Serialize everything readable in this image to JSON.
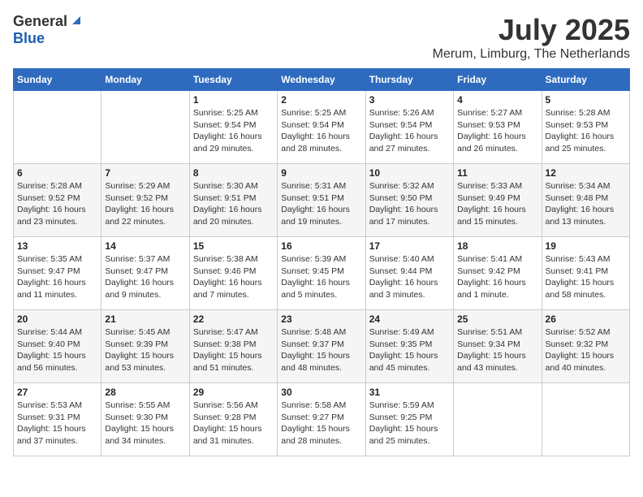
{
  "logo": {
    "general": "General",
    "blue": "Blue"
  },
  "title": {
    "month": "July 2025",
    "location": "Merum, Limburg, The Netherlands"
  },
  "header_days": [
    "Sunday",
    "Monday",
    "Tuesday",
    "Wednesday",
    "Thursday",
    "Friday",
    "Saturday"
  ],
  "weeks": [
    {
      "days": [
        {
          "num": "",
          "info": ""
        },
        {
          "num": "",
          "info": ""
        },
        {
          "num": "1",
          "info": "Sunrise: 5:25 AM\nSunset: 9:54 PM\nDaylight: 16 hours\nand 29 minutes."
        },
        {
          "num": "2",
          "info": "Sunrise: 5:25 AM\nSunset: 9:54 PM\nDaylight: 16 hours\nand 28 minutes."
        },
        {
          "num": "3",
          "info": "Sunrise: 5:26 AM\nSunset: 9:54 PM\nDaylight: 16 hours\nand 27 minutes."
        },
        {
          "num": "4",
          "info": "Sunrise: 5:27 AM\nSunset: 9:53 PM\nDaylight: 16 hours\nand 26 minutes."
        },
        {
          "num": "5",
          "info": "Sunrise: 5:28 AM\nSunset: 9:53 PM\nDaylight: 16 hours\nand 25 minutes."
        }
      ]
    },
    {
      "days": [
        {
          "num": "6",
          "info": "Sunrise: 5:28 AM\nSunset: 9:52 PM\nDaylight: 16 hours\nand 23 minutes."
        },
        {
          "num": "7",
          "info": "Sunrise: 5:29 AM\nSunset: 9:52 PM\nDaylight: 16 hours\nand 22 minutes."
        },
        {
          "num": "8",
          "info": "Sunrise: 5:30 AM\nSunset: 9:51 PM\nDaylight: 16 hours\nand 20 minutes."
        },
        {
          "num": "9",
          "info": "Sunrise: 5:31 AM\nSunset: 9:51 PM\nDaylight: 16 hours\nand 19 minutes."
        },
        {
          "num": "10",
          "info": "Sunrise: 5:32 AM\nSunset: 9:50 PM\nDaylight: 16 hours\nand 17 minutes."
        },
        {
          "num": "11",
          "info": "Sunrise: 5:33 AM\nSunset: 9:49 PM\nDaylight: 16 hours\nand 15 minutes."
        },
        {
          "num": "12",
          "info": "Sunrise: 5:34 AM\nSunset: 9:48 PM\nDaylight: 16 hours\nand 13 minutes."
        }
      ]
    },
    {
      "days": [
        {
          "num": "13",
          "info": "Sunrise: 5:35 AM\nSunset: 9:47 PM\nDaylight: 16 hours\nand 11 minutes."
        },
        {
          "num": "14",
          "info": "Sunrise: 5:37 AM\nSunset: 9:47 PM\nDaylight: 16 hours\nand 9 minutes."
        },
        {
          "num": "15",
          "info": "Sunrise: 5:38 AM\nSunset: 9:46 PM\nDaylight: 16 hours\nand 7 minutes."
        },
        {
          "num": "16",
          "info": "Sunrise: 5:39 AM\nSunset: 9:45 PM\nDaylight: 16 hours\nand 5 minutes."
        },
        {
          "num": "17",
          "info": "Sunrise: 5:40 AM\nSunset: 9:44 PM\nDaylight: 16 hours\nand 3 minutes."
        },
        {
          "num": "18",
          "info": "Sunrise: 5:41 AM\nSunset: 9:42 PM\nDaylight: 16 hours\nand 1 minute."
        },
        {
          "num": "19",
          "info": "Sunrise: 5:43 AM\nSunset: 9:41 PM\nDaylight: 15 hours\nand 58 minutes."
        }
      ]
    },
    {
      "days": [
        {
          "num": "20",
          "info": "Sunrise: 5:44 AM\nSunset: 9:40 PM\nDaylight: 15 hours\nand 56 minutes."
        },
        {
          "num": "21",
          "info": "Sunrise: 5:45 AM\nSunset: 9:39 PM\nDaylight: 15 hours\nand 53 minutes."
        },
        {
          "num": "22",
          "info": "Sunrise: 5:47 AM\nSunset: 9:38 PM\nDaylight: 15 hours\nand 51 minutes."
        },
        {
          "num": "23",
          "info": "Sunrise: 5:48 AM\nSunset: 9:37 PM\nDaylight: 15 hours\nand 48 minutes."
        },
        {
          "num": "24",
          "info": "Sunrise: 5:49 AM\nSunset: 9:35 PM\nDaylight: 15 hours\nand 45 minutes."
        },
        {
          "num": "25",
          "info": "Sunrise: 5:51 AM\nSunset: 9:34 PM\nDaylight: 15 hours\nand 43 minutes."
        },
        {
          "num": "26",
          "info": "Sunrise: 5:52 AM\nSunset: 9:32 PM\nDaylight: 15 hours\nand 40 minutes."
        }
      ]
    },
    {
      "days": [
        {
          "num": "27",
          "info": "Sunrise: 5:53 AM\nSunset: 9:31 PM\nDaylight: 15 hours\nand 37 minutes."
        },
        {
          "num": "28",
          "info": "Sunrise: 5:55 AM\nSunset: 9:30 PM\nDaylight: 15 hours\nand 34 minutes."
        },
        {
          "num": "29",
          "info": "Sunrise: 5:56 AM\nSunset: 9:28 PM\nDaylight: 15 hours\nand 31 minutes."
        },
        {
          "num": "30",
          "info": "Sunrise: 5:58 AM\nSunset: 9:27 PM\nDaylight: 15 hours\nand 28 minutes."
        },
        {
          "num": "31",
          "info": "Sunrise: 5:59 AM\nSunset: 9:25 PM\nDaylight: 15 hours\nand 25 minutes."
        },
        {
          "num": "",
          "info": ""
        },
        {
          "num": "",
          "info": ""
        }
      ]
    }
  ]
}
